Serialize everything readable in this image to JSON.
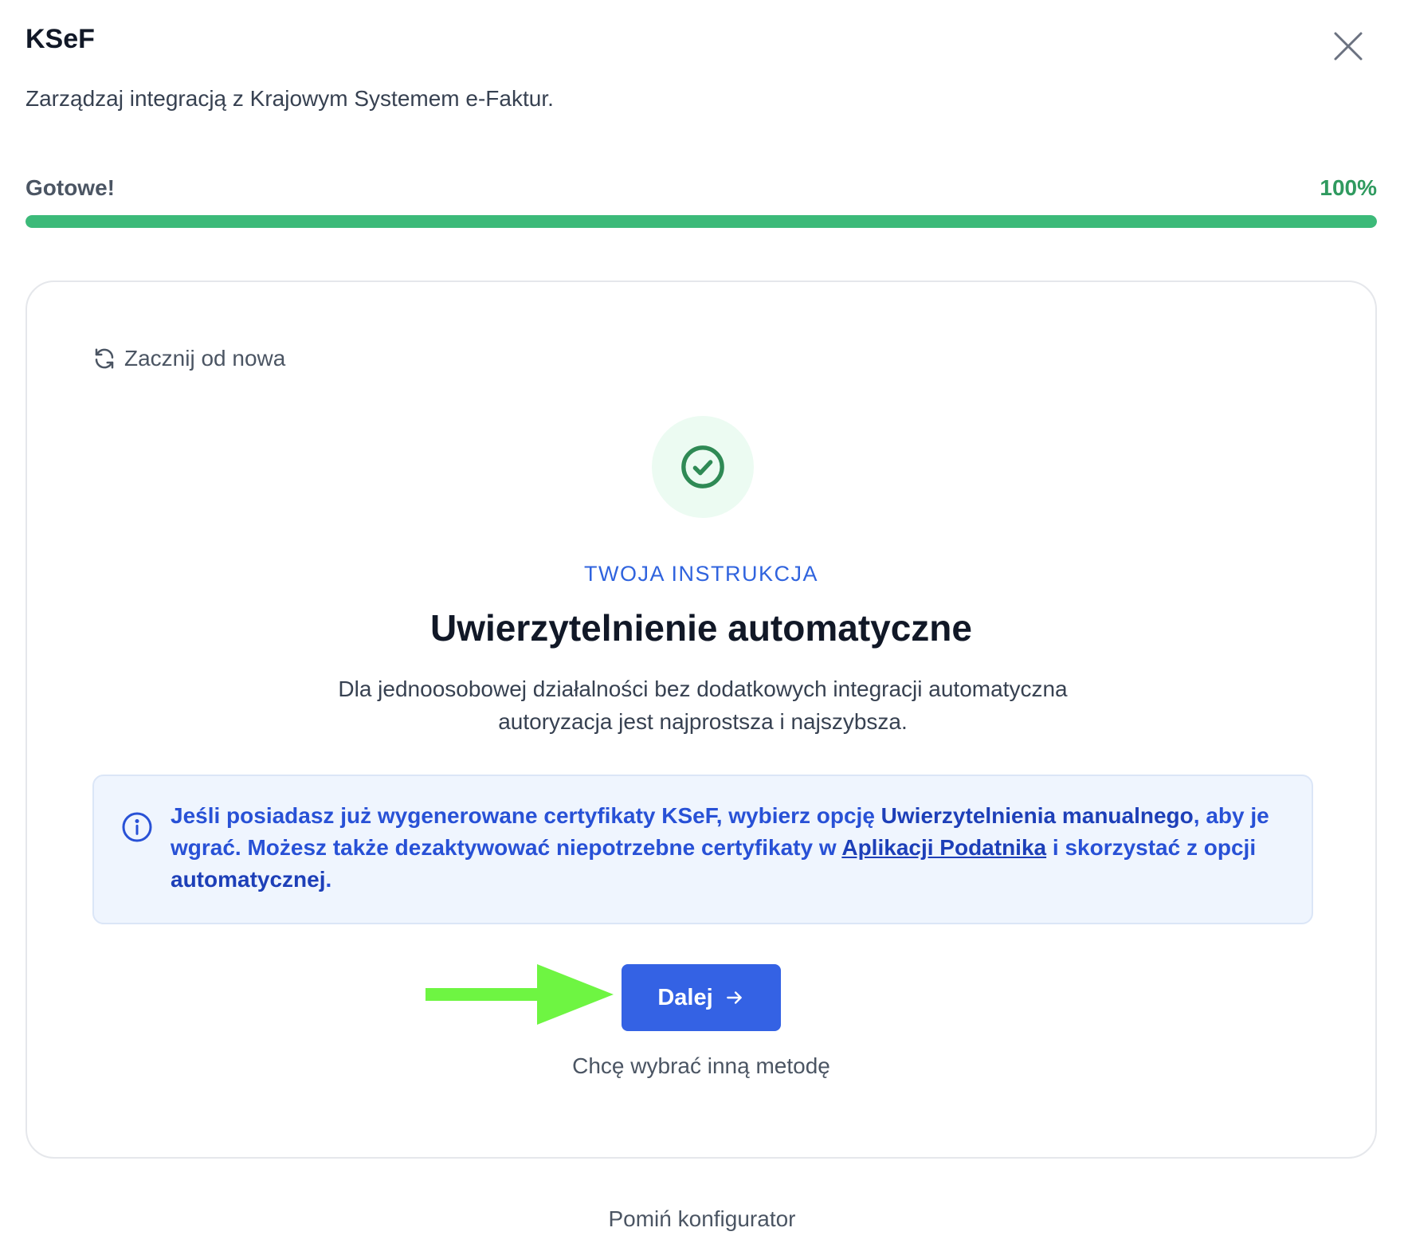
{
  "header": {
    "title": "KSeF",
    "subtitle": "Zarządzaj integracją z Krajowym Systemem e-Faktur.",
    "close_icon": "close-icon"
  },
  "progress": {
    "label": "Gotowe!",
    "value_text": "100%",
    "value": 100,
    "color": "#3cba79"
  },
  "card": {
    "restart_label": "Zacznij od nowa",
    "restart_icon": "refresh-icon",
    "status_icon": "check-circle-icon",
    "eyebrow": "TWOJA INSTRUKCJA",
    "title": "Uwierzytelnienie automatyczne",
    "description": "Dla jednoosobowej działalności bez dodatkowych integracji automatyczna autoryzacja jest najprostsza i najszybsza.",
    "info": {
      "icon": "info-icon",
      "part1": "Jeśli posiadasz już wygenerowane certyfikaty KSeF, wybierz opcję ",
      "bold1": "Uwierzytelnienia manualnego",
      "part2": ", aby je wgrać. Możesz także dezaktywować niepotrzebne certyfikaty w ",
      "link": "Aplikacji Podatnika",
      "part3": " i skorzystać z opcji ",
      "bold2": "automatycznej",
      "part4": "."
    },
    "next_label": "Dalej",
    "next_icon": "arrow-right-icon",
    "other_method_label": "Chcę wybrać inną metodę"
  },
  "footer": {
    "skip_label": "Pomiń konfigurator"
  },
  "colors": {
    "accent": "#3462e4",
    "success": "#2f9a5f",
    "annotation_arrow": "#6ef542"
  }
}
